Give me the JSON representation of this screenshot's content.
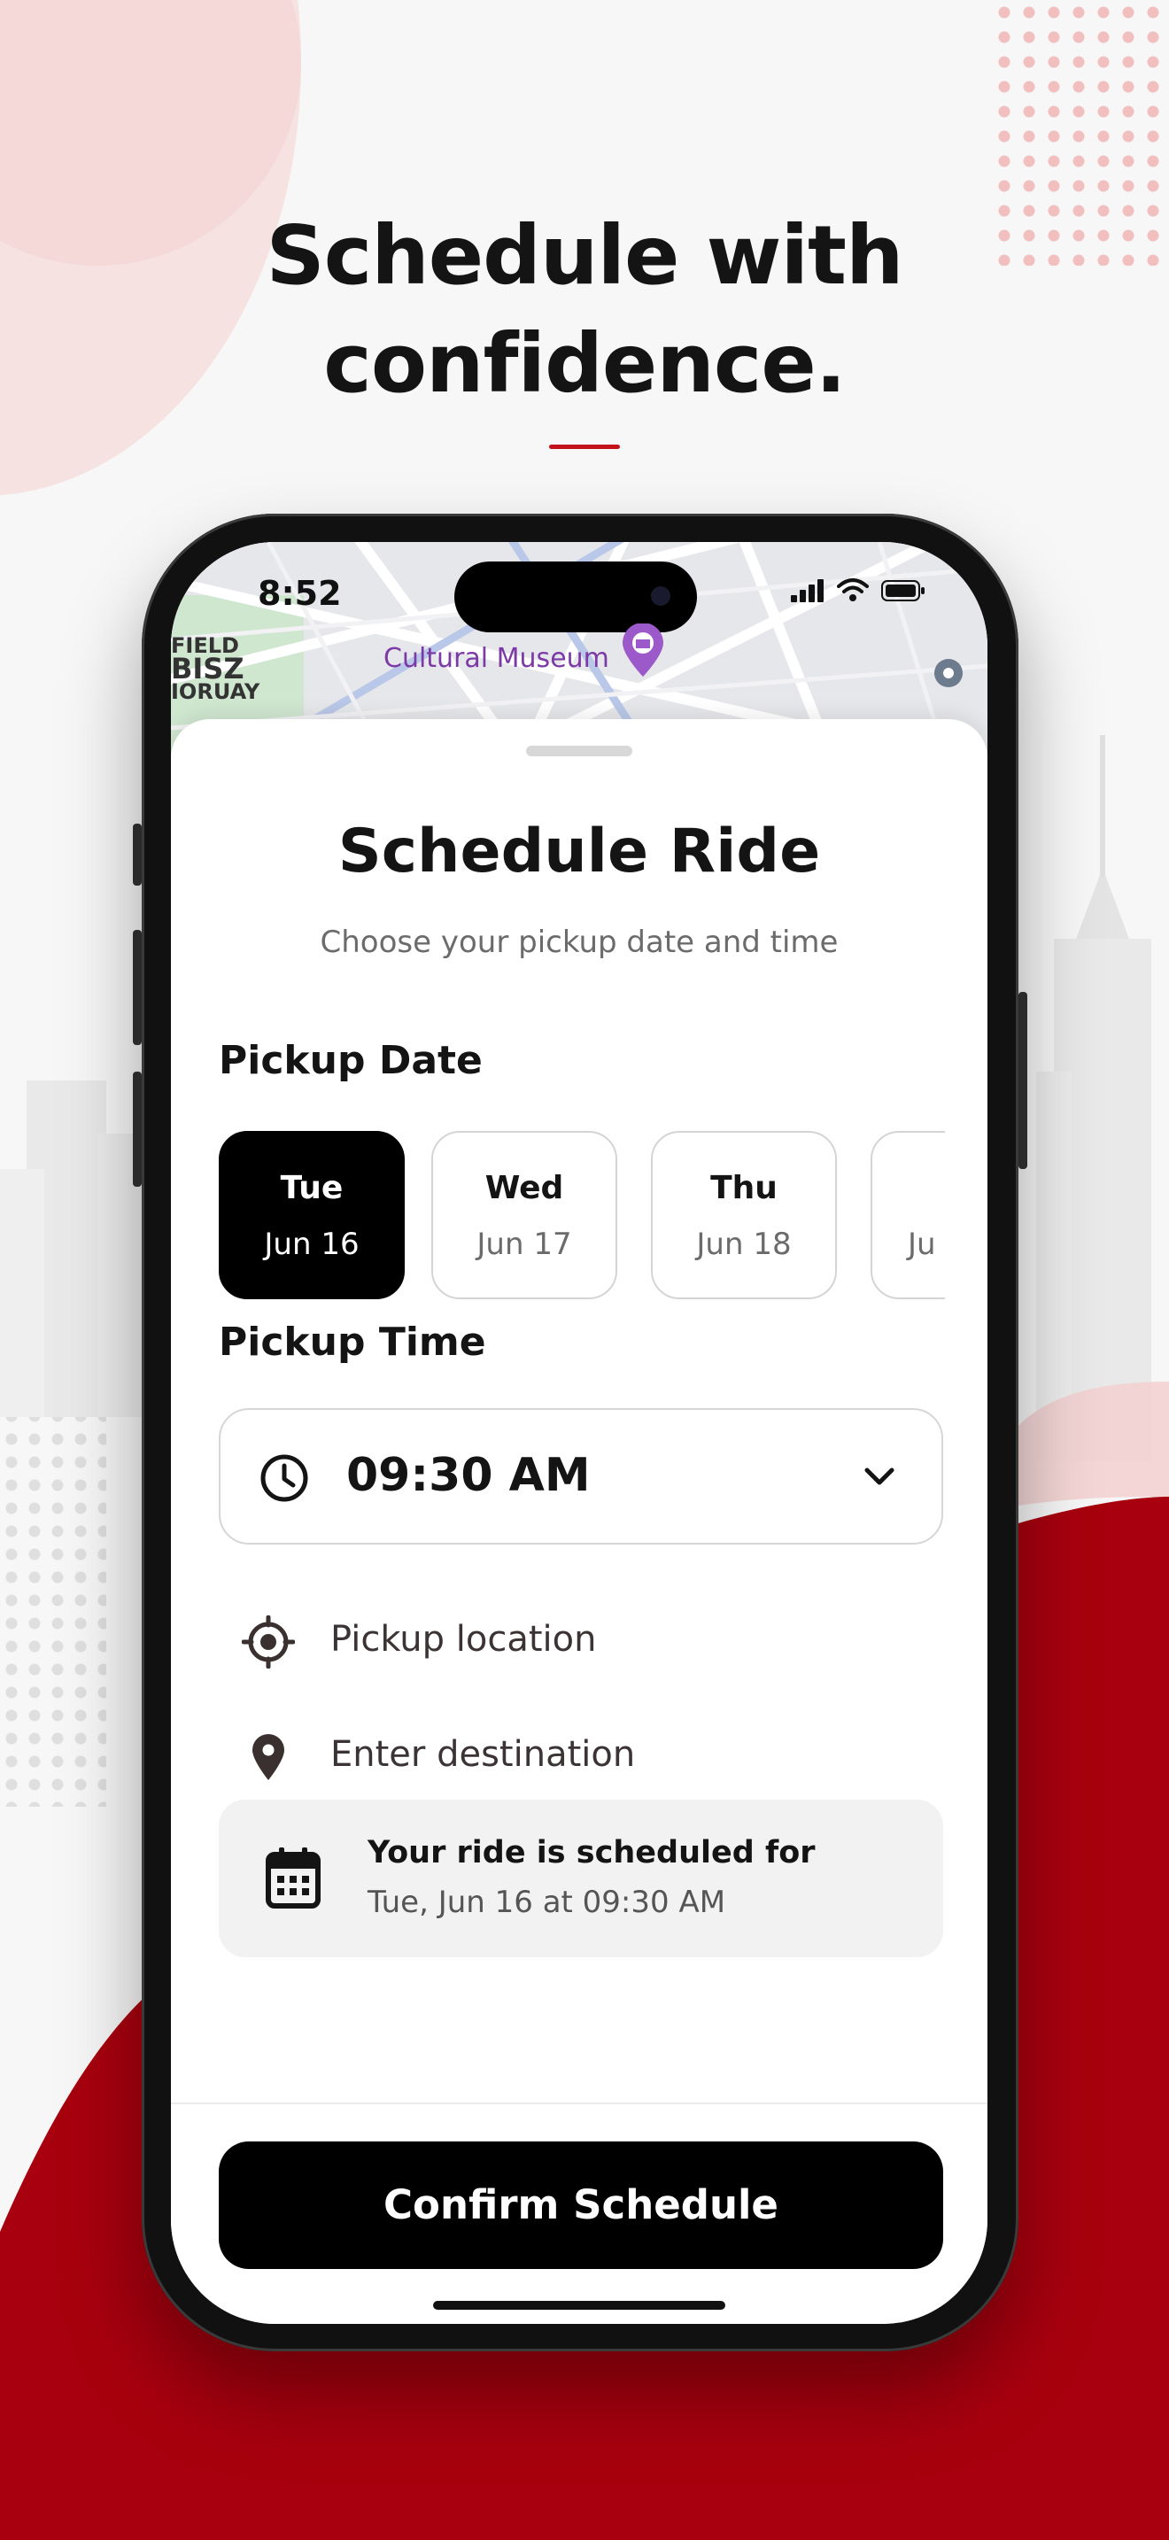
{
  "headline": {
    "line1": "Schedule with",
    "line2": "confidence."
  },
  "status_bar": {
    "time": "8:52"
  },
  "map": {
    "poi_label": "Cultural Museum",
    "corner_labels": [
      "FIELD",
      "BISZ",
      "IORUAY"
    ]
  },
  "sheet": {
    "title": "Schedule Ride",
    "subtitle": "Choose your pickup date and time"
  },
  "pickup_date": {
    "label": "Pickup Date",
    "dates": [
      {
        "day": "Tue",
        "date": "Jun 16",
        "selected": true
      },
      {
        "day": "Wed",
        "date": "Jun 17",
        "selected": false
      },
      {
        "day": "Thu",
        "date": "Jun 18",
        "selected": false
      },
      {
        "day": "",
        "date": "Ju",
        "selected": false
      }
    ]
  },
  "pickup_time": {
    "label": "Pickup Time",
    "value": "09:30 AM"
  },
  "locations": {
    "pickup_placeholder": "Pickup location",
    "destination_placeholder": "Enter destination"
  },
  "summary": {
    "title": "Your ride is scheduled for",
    "detail": "Tue, Jun 16 at 09:30 AM"
  },
  "confirm_button": {
    "label": "Confirm Schedule"
  },
  "colors": {
    "accent_red": "#a8000e",
    "primary_black": "#000000",
    "rule_red": "#c3121b",
    "map_poi_purple": "#7b3aa6"
  },
  "icons": {
    "time": "clock-icon",
    "dropdown": "chevron-down-icon",
    "pickup": "crosshair-icon",
    "destination": "map-pin-icon",
    "summary": "calendar-icon"
  }
}
